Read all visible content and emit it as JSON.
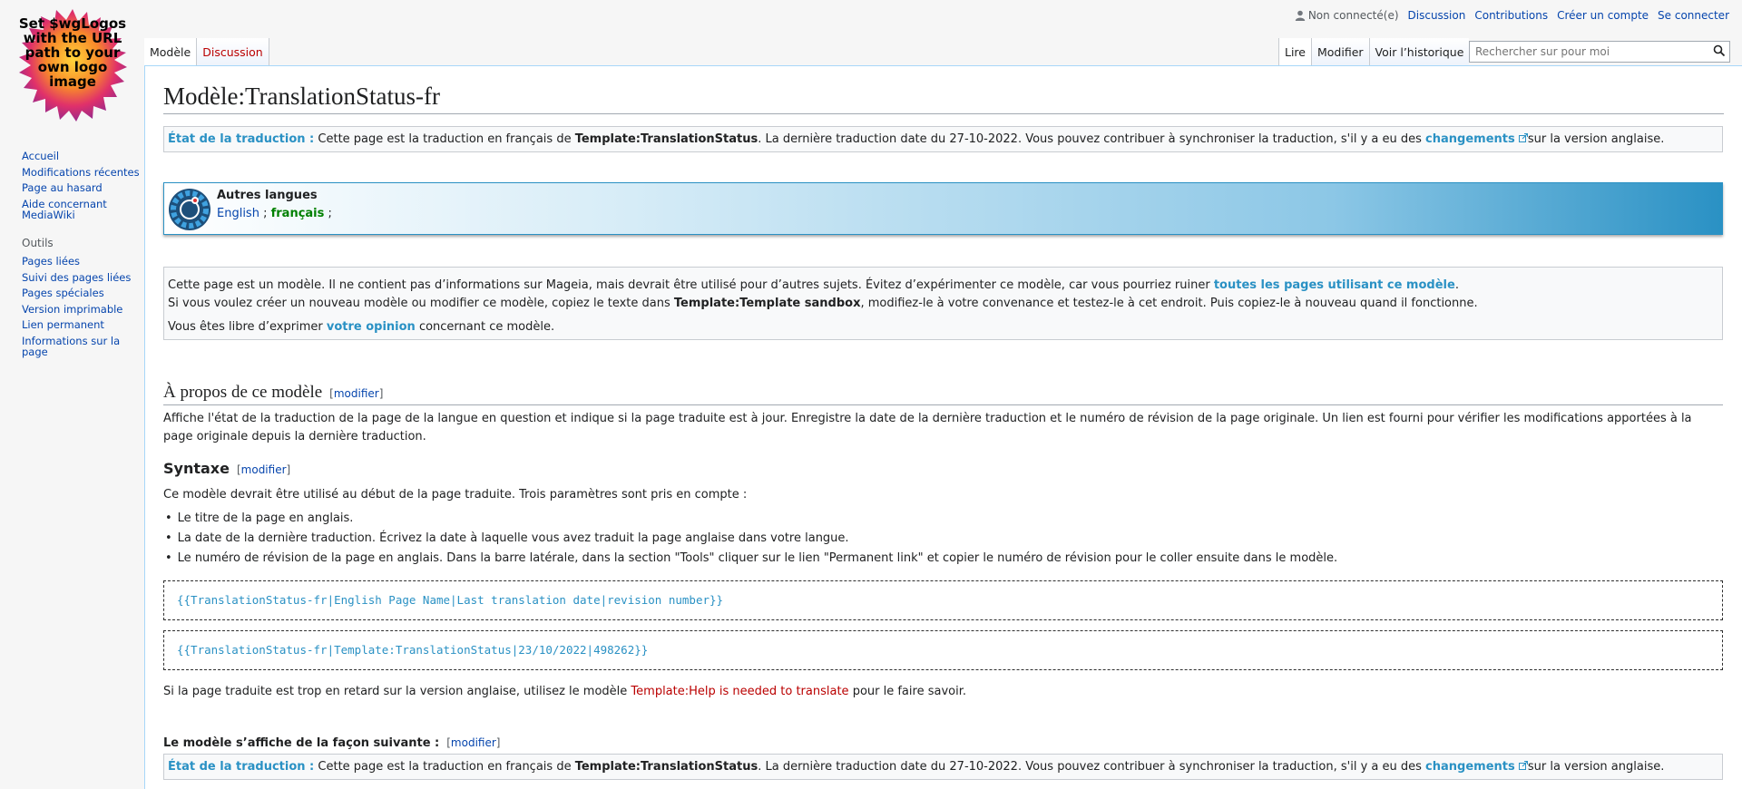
{
  "logo": {
    "text": "Set $wgLogos with the URL path to your own logo image"
  },
  "personal": {
    "not_logged_in": "Non connecté(e)",
    "discussion": "Discussion",
    "contributions": "Contributions",
    "create_account": "Créer un compte",
    "login": "Se connecter"
  },
  "tabs": {
    "left": [
      "Modèle",
      "Discussion"
    ],
    "right": [
      "Lire",
      "Modifier",
      "Voir l’historique"
    ]
  },
  "search": {
    "placeholder": "Rechercher sur pour moi"
  },
  "sidebar": {
    "nav": [
      "Accueil",
      "Modifications récentes",
      "Page au hasard",
      "Aide concernant MediaWiki"
    ],
    "tools_title": "Outils",
    "tools": [
      "Pages liées",
      "Suivi des pages liées",
      "Pages spéciales",
      "Version imprimable",
      "Lien permanent",
      "Informations sur la page"
    ]
  },
  "page": {
    "title": "Modèle:TranslationStatus-fr",
    "status": {
      "label": "État de la traduction :",
      "text1": " Cette page est la traduction en français de ",
      "source": "Template:TranslationStatus",
      "text2": ". La dernière traduction date du 27-10-2022. Vous pouvez contribuer à synchroniser la traduction, s'il y a eu des ",
      "changes": "changements",
      "text3": "sur la version anglaise."
    },
    "languages": {
      "title": "Autres langues",
      "english": "English",
      "sep": " ; ",
      "francais": "français",
      "end": " ;"
    },
    "template_notice": {
      "line1": "Cette page est un modèle. Il ne contient pas d’informations sur Mageia, mais devrait être utilisé pour d’autres sujets. Évitez d’expérimenter ce modèle, car vous pourriez ruiner ",
      "line1_link": "toutes les pages utilisant ce modèle",
      "line1_end": ".",
      "line2a": "Si vous voulez créer un nouveau modèle ou modifier ce modèle, copiez le texte dans ",
      "line2_bold": "Template:Template sandbox",
      "line2b": ", modifiez-le à votre convenance et testez-le à cet endroit. Puis copiez-le à nouveau quand il fonctionne.",
      "line3a": "Vous êtes libre d’exprimer ",
      "line3_link": "votre opinion",
      "line3b": " concernant ce modèle."
    },
    "about": {
      "heading": "À propos de ce modèle",
      "edit_open": "[",
      "edit": "modifier",
      "edit_close": "]",
      "text": "Affiche l'état de la traduction de la page de la langue en question et indique si la page traduite est à jour. Enregistre la date de la dernière traduction et le numéro de révision de la page originale. Un lien est fourni pour vérifier les modifications apportées à la page originale depuis la dernière traduction."
    },
    "syntax": {
      "heading": "Syntaxe",
      "intro": "Ce modèle devrait être utilisé au début de la page traduite. Trois paramètres sont pris en compte :",
      "items": [
        "Le titre de la page en anglais.",
        "La date de la dernière traduction. Écrivez la date à laquelle vous avez traduit la page anglaise dans votre langue.",
        "Le numéro de révision de la page en anglais. Dans la barre latérale, dans la section \"Tools\" cliquer sur le lien \"Permanent link\" et copier le numéro de révision pour le coller ensuite dans le modèle."
      ],
      "code1": "{{TranslationStatus-fr|English Page Name|Last translation date|revision number}}",
      "code2": "{{TranslationStatus-fr|Template:TranslationStatus|23/10/2022|498262}}",
      "late_a": "Si la page traduite est trop en retard sur la version anglaise, utilisez le modèle ",
      "late_link": "Template:Help is needed to translate",
      "late_b": " pour le faire savoir."
    },
    "display": {
      "heading": "Le modèle s’affiche de la façon suivante :"
    }
  }
}
